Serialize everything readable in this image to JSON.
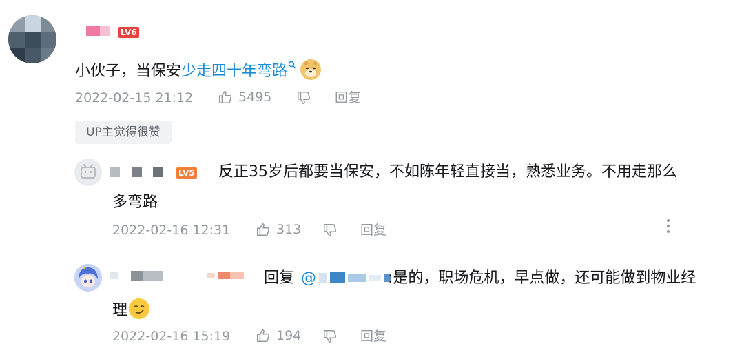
{
  "comments": [
    {
      "level": "LV6",
      "content_prefix": "小伙子，当保安",
      "content_link": "少走四十年弯路",
      "time": "2022-02-15 21:12",
      "likes": "5495",
      "reply_label": "回复",
      "up_badge": "UP主觉得很赞"
    }
  ],
  "replies": [
    {
      "level": "LV5",
      "content_line1": "反正35岁后都要当保安，不如陈年轻直接当，熟悉业务。不用走那么",
      "content_line2": "多弯路",
      "time": "2022-02-16 12:31",
      "likes": "313",
      "reply_label": "回复"
    },
    {
      "reply_word": "回复",
      "mention_prefix": "@",
      "content_line1": ":是的，职场危机，早点做，还可能做到物业经",
      "content_line2": "理",
      "time": "2022-02-16 15:19",
      "likes": "194",
      "reply_label": "回复"
    }
  ],
  "icons": {
    "like": "thumbs-up-icon",
    "dislike": "thumbs-down-icon",
    "search": "search-icon",
    "more": "more-vertical-icon"
  },
  "colors": {
    "link": "#1a8bd6",
    "meta": "#9499a0",
    "lv6": "#e8433c",
    "lv5": "#f0803a"
  }
}
